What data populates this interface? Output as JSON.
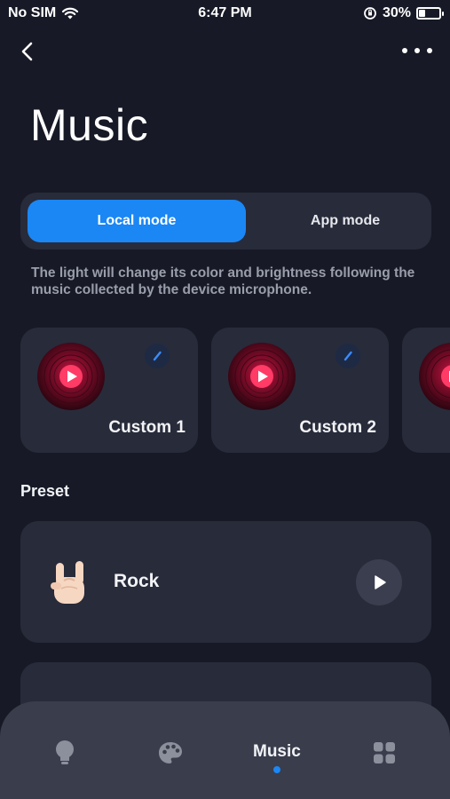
{
  "status_bar": {
    "carrier": "No SIM",
    "time": "6:47 PM",
    "battery_percent": "30%",
    "battery_level": 0.3
  },
  "header": {
    "title": "Music",
    "back_icon": "chevron-left-icon",
    "more_icon": "more-horizontal-icon"
  },
  "mode_toggle": {
    "local_label": "Local mode",
    "app_label": "App mode",
    "selected": "Local mode",
    "accent_color": "#1a87f5"
  },
  "description": "The light will change its color and brightness following the music collected by the device microphone.",
  "custom_cards": [
    {
      "label": "Custom 1",
      "icon": "vinyl-record-icon",
      "edit_icon": "pencil-icon"
    },
    {
      "label": "Custom 2",
      "icon": "vinyl-record-icon",
      "edit_icon": "pencil-icon"
    }
  ],
  "preset_section": {
    "title": "Preset",
    "items": [
      {
        "label": "Rock",
        "icon": "rock-hand-icon",
        "action_icon": "play-icon"
      }
    ]
  },
  "tab_bar": {
    "tabs": [
      {
        "icon": "bulb-icon"
      },
      {
        "icon": "palette-icon"
      },
      {
        "label": "Music",
        "active": true
      },
      {
        "icon": "grid-icon"
      }
    ]
  }
}
